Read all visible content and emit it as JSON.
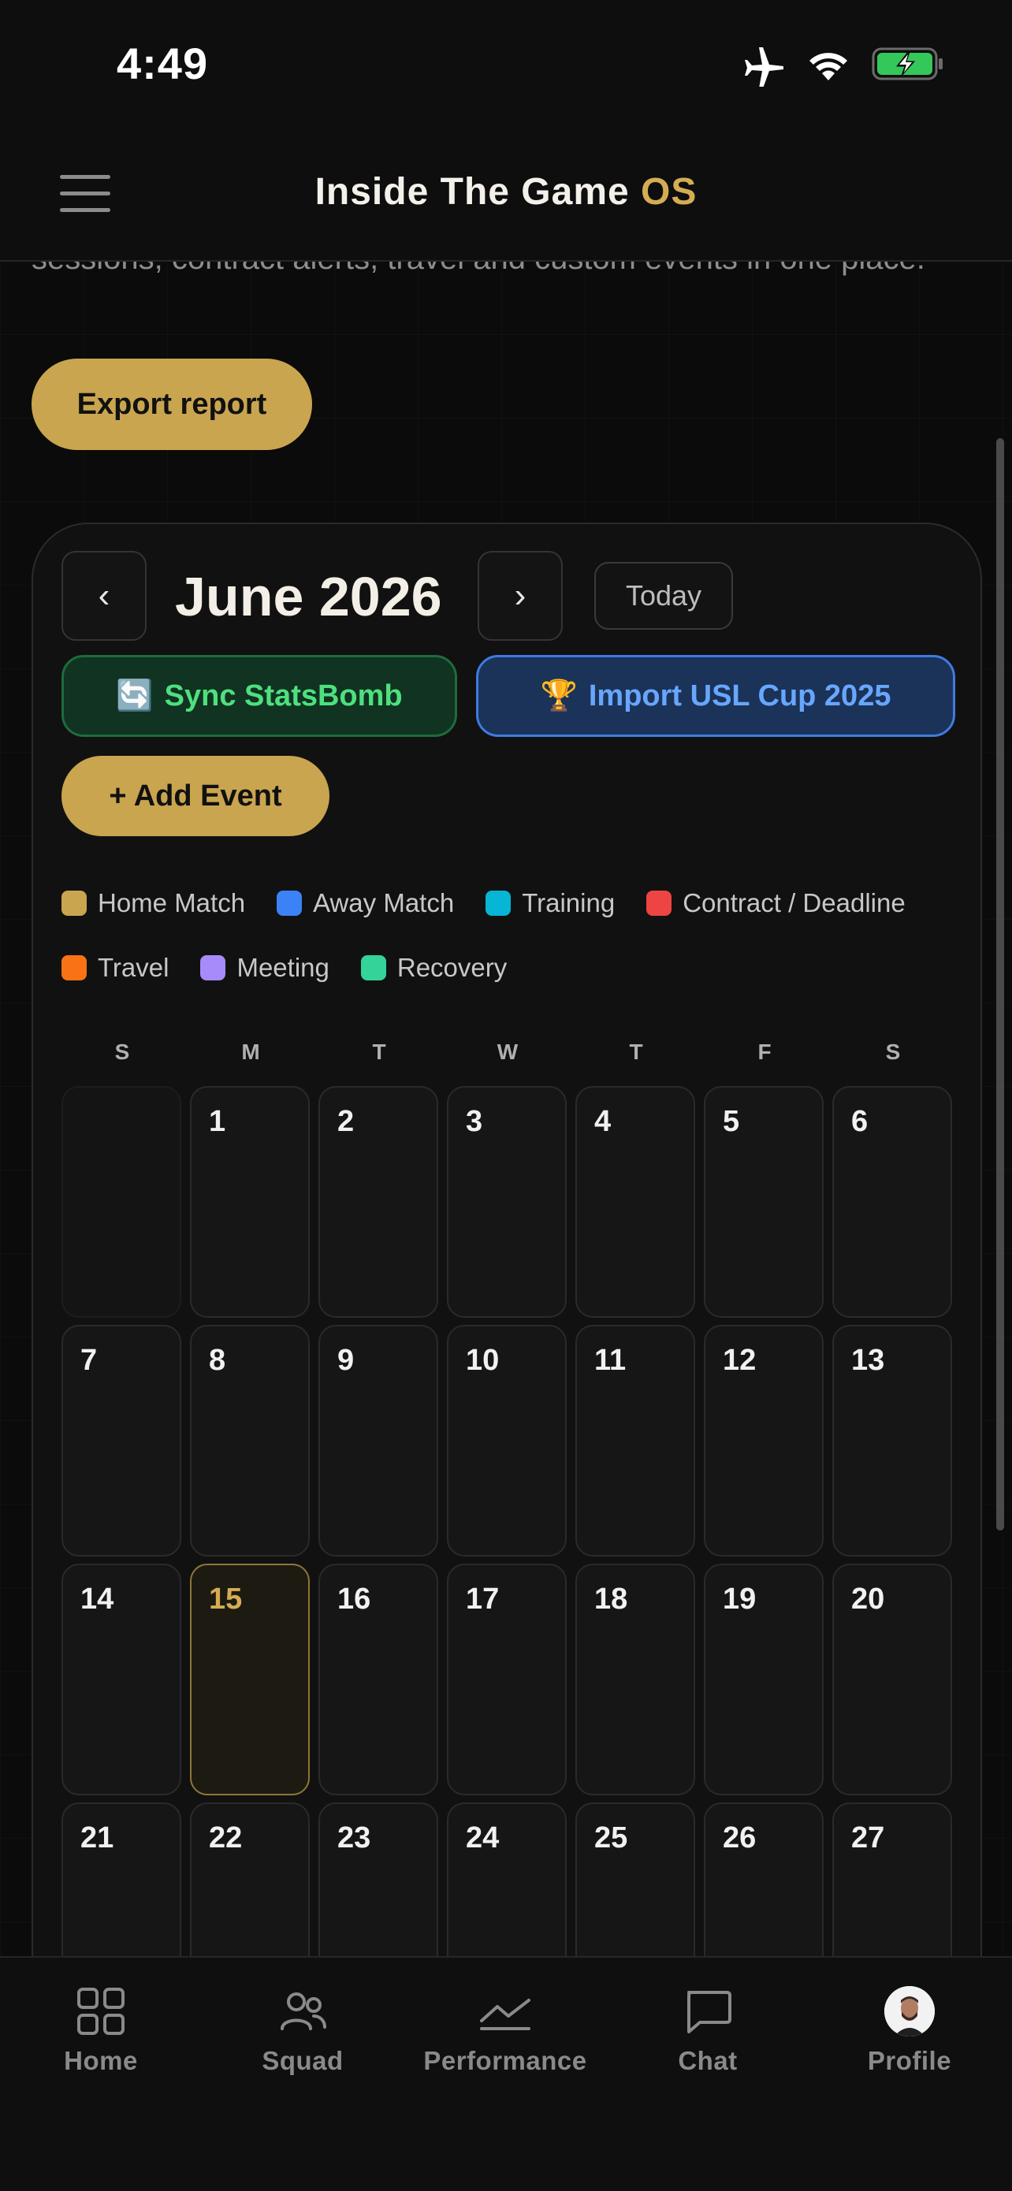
{
  "status_bar": {
    "time": "4:49"
  },
  "header": {
    "title_main": "Inside The Game",
    "title_accent": "OS"
  },
  "intro": {
    "text": "sessions, contract alerts, travel and custom events in one place.",
    "export_label": "Export report"
  },
  "calendar": {
    "prev_label": "‹",
    "next_label": "›",
    "month_title": "June 2026",
    "today_label": "Today",
    "sync_label": "Sync StatsBomb",
    "sync_emoji": "🔄",
    "import_label": "Import USL Cup 2025",
    "import_emoji": "🏆",
    "add_event_label": "+ Add Event",
    "legend": [
      {
        "label": "Home Match",
        "color": "#c9a54f"
      },
      {
        "label": "Away Match",
        "color": "#3b82f6"
      },
      {
        "label": "Training",
        "color": "#06b6d4"
      },
      {
        "label": "Contract / Deadline",
        "color": "#ef4444"
      },
      {
        "label": "Travel",
        "color": "#f97316"
      },
      {
        "label": "Meeting",
        "color": "#a78bfa"
      },
      {
        "label": "Recovery",
        "color": "#34d399"
      }
    ],
    "weekdays": [
      "S",
      "M",
      "T",
      "W",
      "T",
      "F",
      "S"
    ],
    "today": 15,
    "days": [
      "",
      "1",
      "2",
      "3",
      "4",
      "5",
      "6",
      "7",
      "8",
      "9",
      "10",
      "11",
      "12",
      "13",
      "14",
      "15",
      "16",
      "17",
      "18",
      "19",
      "20",
      "21",
      "22",
      "23",
      "24",
      "25",
      "26",
      "27"
    ]
  },
  "tab_bar": {
    "items": [
      {
        "label": "Home",
        "icon": "grid-icon"
      },
      {
        "label": "Squad",
        "icon": "users-icon"
      },
      {
        "label": "Performance",
        "icon": "trend-icon"
      },
      {
        "label": "Chat",
        "icon": "chat-icon"
      },
      {
        "label": "Profile",
        "icon": "avatar"
      }
    ]
  }
}
